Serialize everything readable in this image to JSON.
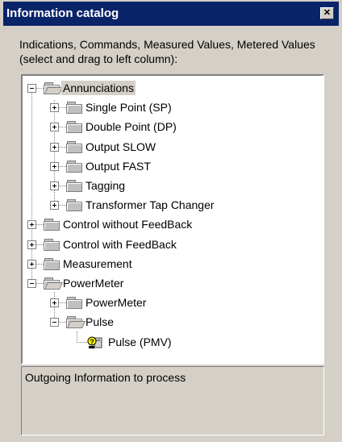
{
  "window": {
    "title": "Information catalog",
    "close_glyph": "✕"
  },
  "instruction": "Indications, Commands, Measured Values, Metered Values (select and drag to left column):",
  "tree": [
    {
      "label": "Annunciations",
      "level": 0,
      "expanded": true,
      "selected": true,
      "icon": "folder-open-icon"
    },
    {
      "label": "Single Point (SP)",
      "level": 1,
      "expanded": false,
      "icon": "folder-icon"
    },
    {
      "label": "Double Point (DP)",
      "level": 1,
      "expanded": false,
      "icon": "folder-icon"
    },
    {
      "label": "Output SLOW",
      "level": 1,
      "expanded": false,
      "icon": "folder-icon"
    },
    {
      "label": "Output FAST",
      "level": 1,
      "expanded": false,
      "icon": "folder-icon"
    },
    {
      "label": "Tagging",
      "level": 1,
      "expanded": false,
      "icon": "folder-icon"
    },
    {
      "label": "Transformer Tap Changer",
      "level": 1,
      "expanded": false,
      "icon": "folder-icon"
    },
    {
      "label": "Control without FeedBack",
      "level": 0,
      "expanded": false,
      "icon": "folder-icon"
    },
    {
      "label": "Control with FeedBack",
      "level": 0,
      "expanded": false,
      "icon": "folder-icon"
    },
    {
      "label": "Measurement",
      "level": 0,
      "expanded": false,
      "icon": "folder-icon"
    },
    {
      "label": "PowerMeter",
      "level": 0,
      "expanded": true,
      "icon": "folder-open-icon"
    },
    {
      "label": "PowerMeter",
      "level": 1,
      "expanded": false,
      "icon": "folder-icon"
    },
    {
      "label": "Pulse",
      "level": 1,
      "expanded": true,
      "icon": "folder-open-icon"
    },
    {
      "label": "Pulse (PMV)",
      "level": 2,
      "leaf": true,
      "icon": "pulse-pmv-icon"
    }
  ],
  "status": {
    "text": "Outgoing Information to process"
  },
  "colors": {
    "titlebar": "#0a246a",
    "dialog_bg": "#d4d0c8",
    "tree_bg": "#ffffff"
  }
}
